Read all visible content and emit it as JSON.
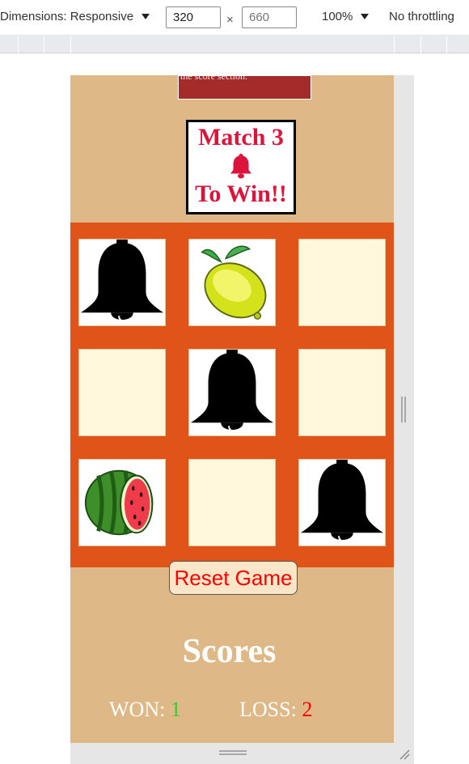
{
  "devtools": {
    "dimensions_label": "Dimensions: Responsive",
    "width_value": "320",
    "height_placeholder": "660",
    "times_sign": "×",
    "zoom": "100%",
    "throttling": "No throttling"
  },
  "game": {
    "instructions_fragment": "the score section.",
    "title_line1": "Match 3",
    "title_icon": "bell-icon",
    "title_line3": "To Win!!",
    "board": [
      {
        "row": 1,
        "col": 1,
        "state": "revealed",
        "icon": "bell-icon"
      },
      {
        "row": 1,
        "col": 2,
        "state": "revealed",
        "icon": "lemon-icon"
      },
      {
        "row": 1,
        "col": 3,
        "state": "hidden",
        "icon": ""
      },
      {
        "row": 2,
        "col": 1,
        "state": "hidden",
        "icon": ""
      },
      {
        "row": 2,
        "col": 2,
        "state": "revealed",
        "icon": "bell-icon"
      },
      {
        "row": 2,
        "col": 3,
        "state": "hidden",
        "icon": ""
      },
      {
        "row": 3,
        "col": 1,
        "state": "revealed",
        "icon": "watermelon-icon"
      },
      {
        "row": 3,
        "col": 2,
        "state": "hidden",
        "icon": ""
      },
      {
        "row": 3,
        "col": 3,
        "state": "revealed",
        "icon": "bell-icon"
      }
    ],
    "reset_label": "Reset Game",
    "scores_title": "Scores",
    "won_label": "WON:",
    "won_value": "1",
    "loss_label": "LOSS:",
    "loss_value": "2"
  },
  "colors": {
    "page_bg": "#deb887",
    "board_bg": "#e0541a",
    "hidden_tile": "#fff8dc",
    "title_red": "#dc143c",
    "won_green": "#32cd32",
    "loss_red": "#ff0000"
  }
}
